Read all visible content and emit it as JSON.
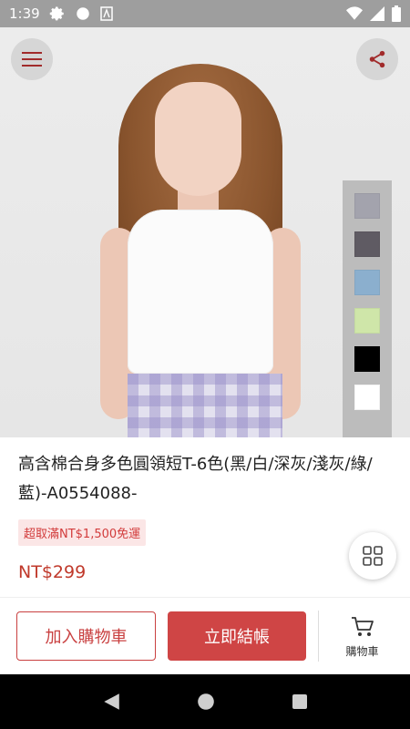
{
  "status_bar": {
    "time": "1:39",
    "icons": [
      "gear-icon",
      "circle-icon",
      "a-icon",
      "wifi-icon",
      "signal-icon",
      "battery-icon"
    ]
  },
  "hero": {
    "icons": {
      "menu": "menu-icon",
      "share": "share-icon"
    },
    "swatches": [
      {
        "color": "#a3a3ad"
      },
      {
        "color": "#5f5b63"
      },
      {
        "color": "#8bafce"
      },
      {
        "color": "#cfe6a9"
      },
      {
        "color": "#000000"
      },
      {
        "color": "#ffffff"
      }
    ]
  },
  "product": {
    "title": "高含棉合身多色圓領短T-6色(黑/白/深灰/淺灰/綠/藍)-A0554088-",
    "badge": "超取滿NT$1,500免運",
    "price": "NT$299"
  },
  "bottom_bar": {
    "add_to_cart": "加入購物車",
    "checkout": "立即結帳",
    "cart_label": "購物車"
  },
  "colors": {
    "accent": "#cf4545",
    "badge_bg": "#fbe6e6"
  }
}
